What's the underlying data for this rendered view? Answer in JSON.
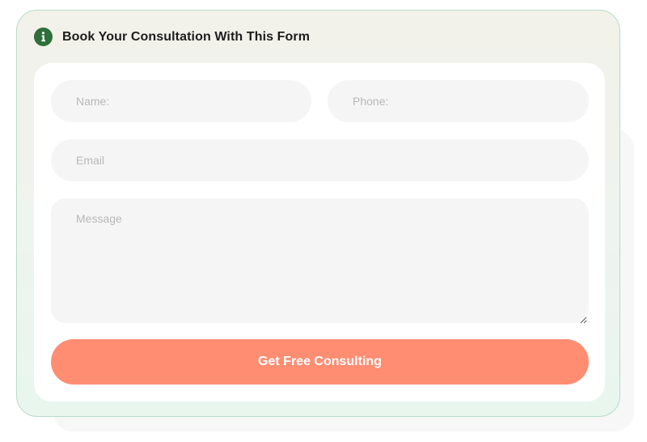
{
  "form": {
    "title": "Book Your Consultation With This Form",
    "icon": "info-icon",
    "accent_color": "#2e6f3b",
    "fields": {
      "name_placeholder": "Name:",
      "phone_placeholder": "Phone:",
      "email_placeholder": "Email",
      "message_placeholder": "Message"
    },
    "submit_label": "Get Free Consulting",
    "submit_color": "#ff8d72"
  }
}
